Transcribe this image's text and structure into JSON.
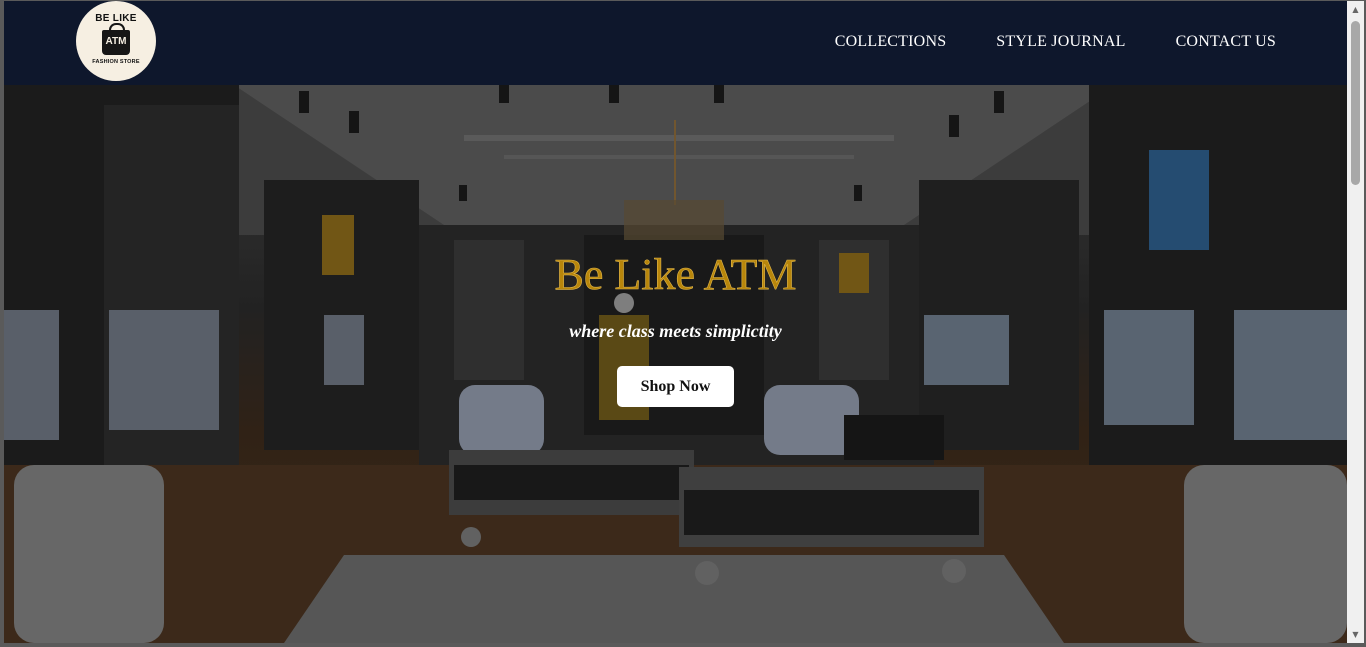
{
  "logo": {
    "top_text": "BE LIKE",
    "bag_text": "ATM",
    "bottom_text": "FASHION STORE"
  },
  "nav": {
    "items": [
      {
        "label": "COLLECTIONS"
      },
      {
        "label": "STYLE JOURNAL"
      },
      {
        "label": "CONTACT US"
      }
    ]
  },
  "hero": {
    "title": "Be Like ATM",
    "subtitle": "where class meets simplictity",
    "cta_label": "Shop Now"
  },
  "colors": {
    "navbar_bg": "#0e172c",
    "title_gold": "#b8860b",
    "button_bg": "#ffffff"
  },
  "icons": {
    "scroll_up": "triangle-up",
    "scroll_down": "triangle-down"
  }
}
